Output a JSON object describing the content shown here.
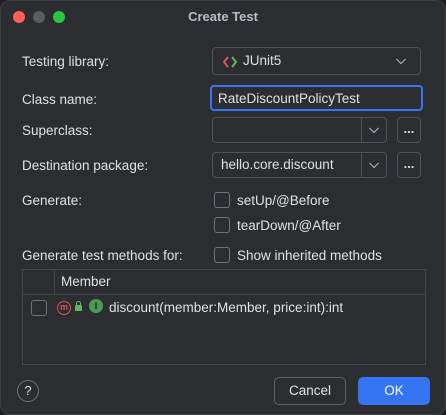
{
  "window": {
    "title": "Create Test"
  },
  "form": {
    "testing_library_label": "Testing library:",
    "testing_library_value": "JUnit5",
    "class_name_label": "Class name:",
    "class_name_value": "RateDiscountPolicyTest",
    "superclass_label": "Superclass:",
    "superclass_value": "",
    "browse_label": "...",
    "destination_label": "Destination package:",
    "destination_value": "hello.core.discount",
    "generate_label": "Generate:",
    "setup_label": "setUp/@Before",
    "teardown_label": "tearDown/@After",
    "generate_methods_label": "Generate test methods for:",
    "show_inherited_label": "Show inherited methods"
  },
  "table": {
    "column_member": "Member",
    "rows": [
      {
        "member": "discount(member:Member, price:int):int",
        "icon_method": "m",
        "icon_interface": "I"
      }
    ]
  },
  "footer": {
    "help": "?",
    "cancel": "Cancel",
    "ok": "OK"
  },
  "colors": {
    "accent": "#3574f0",
    "junit_icon": "#e05555",
    "focus_border": "#3574f0"
  },
  "icons": {
    "junit": "junit-icon",
    "method": "method-icon",
    "lock": "lock-icon",
    "interface": "interface-icon",
    "help": "help-icon"
  }
}
